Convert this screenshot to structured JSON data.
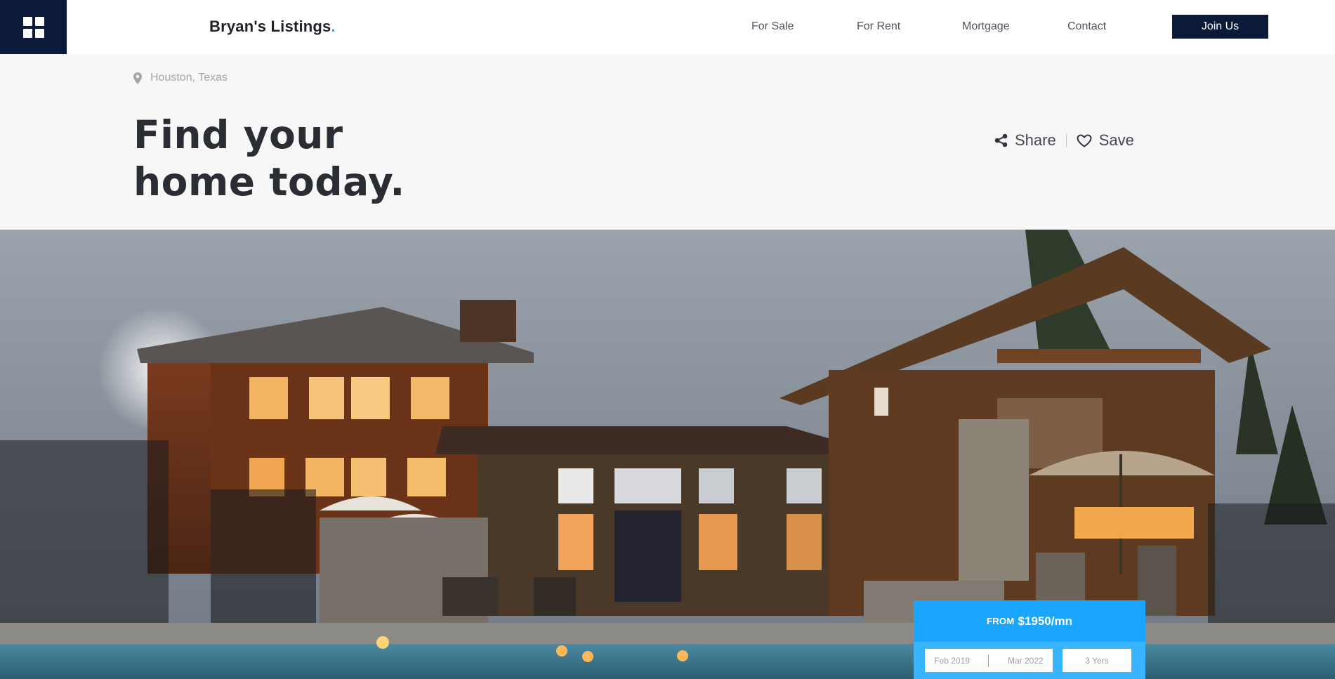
{
  "brand": {
    "name": "Bryan's Listings",
    "dot": "."
  },
  "nav": {
    "links": [
      "For Sale",
      "For Rent",
      "Mortgage",
      "Contact"
    ],
    "cta": "Join Us"
  },
  "hero": {
    "location": "Houston, Texas",
    "headline_line1": "Find your",
    "headline_line2": "home today.",
    "share": "Share",
    "save": "Save"
  },
  "price": {
    "from": "FROM",
    "amount": "$1950/mn",
    "start": "Feb 2019",
    "end": "Mar 2022",
    "term": "3 Yers"
  },
  "colors": {
    "navy": "#0c1a3a",
    "accent": "#1aa6ff",
    "headline": "#2a2d33"
  },
  "icons": [
    "grid-menu-icon",
    "map-pin-icon",
    "share-icon",
    "heart-icon"
  ]
}
